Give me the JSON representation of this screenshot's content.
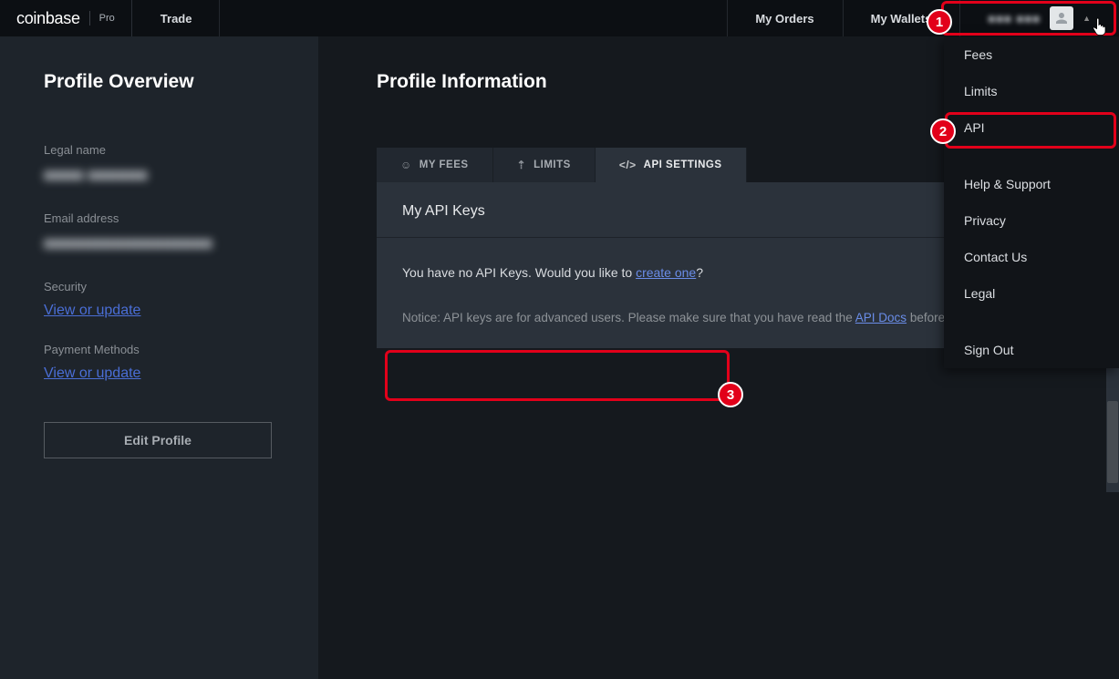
{
  "brand": {
    "main": "coinbase",
    "sub": "Pro"
  },
  "nav": {
    "trade": "Trade",
    "my_orders": "My Orders",
    "my_wallets": "My Wallets",
    "user_redacted": "■■■ ■■■"
  },
  "dropdown": {
    "fees": "Fees",
    "limits": "Limits",
    "api": "API",
    "help": "Help & Support",
    "privacy": "Privacy",
    "contact": "Contact Us",
    "legal": "Legal",
    "signout": "Sign Out"
  },
  "sidebar": {
    "title": "Profile Overview",
    "legal_name_label": "Legal name",
    "legal_name_value": "■■■■ ■■■■■■",
    "email_label": "Email address",
    "email_value": "■■■■■■■■■■■■■■■■■",
    "security_label": "Security",
    "view_or_update": "View or update",
    "payment_label": "Payment Methods",
    "edit_profile": "Edit Profile"
  },
  "main": {
    "title": "Profile Information",
    "tabs": {
      "fees": "MY FEES",
      "limits": "LIMITS",
      "api": "API SETTINGS"
    },
    "panel_title": "My API Keys",
    "add_btn": "+",
    "empty_pre": "You have no API Keys. Would you like to ",
    "empty_link": "create one",
    "empty_post": "?",
    "notice_pre": "Notice: API keys are for advanced users. Please make sure that you have read the ",
    "notice_link": "API Docs",
    "notice_post": " before proceeding."
  },
  "annotations": {
    "one": "1",
    "two": "2",
    "three": "3"
  }
}
